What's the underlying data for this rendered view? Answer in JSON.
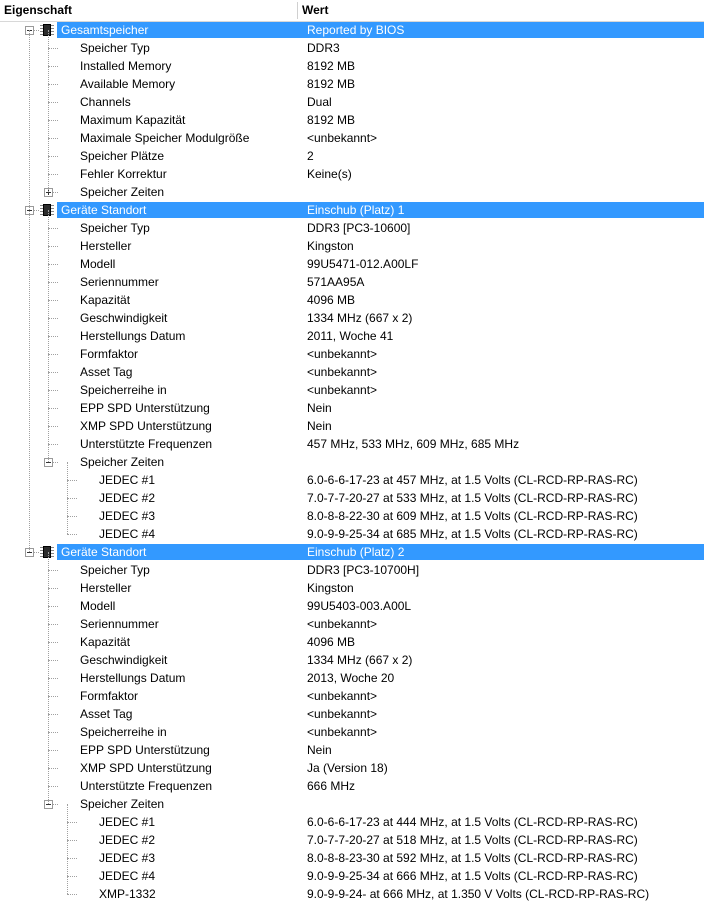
{
  "header": {
    "col1": "Eigenschaft",
    "col2": "Wert"
  },
  "rows": [
    {
      "level": 0,
      "label": "Gesamtspeicher",
      "value": "Reported by BIOS",
      "selected": true,
      "icon": "memory-chip-icon",
      "expander": "minus"
    },
    {
      "level": 1,
      "label": "Speicher Typ",
      "value": "DDR3"
    },
    {
      "level": 1,
      "label": "Installed Memory",
      "value": "8192 MB"
    },
    {
      "level": 1,
      "label": "Available Memory",
      "value": "8192 MB"
    },
    {
      "level": 1,
      "label": "Channels",
      "value": "Dual"
    },
    {
      "level": 1,
      "label": "Maximum Kapazität",
      "value": "8192 MB"
    },
    {
      "level": 1,
      "label": "Maximale Speicher Modulgröße",
      "value": "<unbekannt>"
    },
    {
      "level": 1,
      "label": "Speicher Plätze",
      "value": "2"
    },
    {
      "level": 1,
      "label": "Fehler Korrektur",
      "value": "Keine(s)"
    },
    {
      "level": 1,
      "label": "Speicher Zeiten",
      "value": "",
      "expander": "plus"
    },
    {
      "level": 0,
      "label": "Geräte Standort",
      "value": "Einschub (Platz) 1",
      "selected": true,
      "icon": "memory-chip-icon",
      "expander": "minus"
    },
    {
      "level": 1,
      "label": "Speicher Typ",
      "value": "DDR3 [PC3-10600]"
    },
    {
      "level": 1,
      "label": "Hersteller",
      "value": "Kingston"
    },
    {
      "level": 1,
      "label": "Modell",
      "value": "99U5471-012.A00LF"
    },
    {
      "level": 1,
      "label": "Seriennummer",
      "value": "571AA95A"
    },
    {
      "level": 1,
      "label": "Kapazität",
      "value": "4096 MB"
    },
    {
      "level": 1,
      "label": "Geschwindigkeit",
      "value": "1334 MHz (667 x 2)"
    },
    {
      "level": 1,
      "label": "Herstellungs Datum",
      "value": "2011, Woche 41"
    },
    {
      "level": 1,
      "label": "Formfaktor",
      "value": "<unbekannt>"
    },
    {
      "level": 1,
      "label": "Asset Tag",
      "value": "<unbekannt>"
    },
    {
      "level": 1,
      "label": "Speicherreihe in",
      "value": "<unbekannt>"
    },
    {
      "level": 1,
      "label": "EPP SPD Unterstützung",
      "value": "Nein"
    },
    {
      "level": 1,
      "label": "XMP SPD Unterstützung",
      "value": "Nein"
    },
    {
      "level": 1,
      "label": "Unterstützte Frequenzen",
      "value": "457 MHz, 533 MHz, 609 MHz, 685 MHz"
    },
    {
      "level": 1,
      "label": "Speicher Zeiten",
      "value": "",
      "expander": "minus"
    },
    {
      "level": 2,
      "label": "JEDEC #1",
      "value": "6.0-6-6-17-23 at 457 MHz, at 1.5 Volts (CL-RCD-RP-RAS-RC)"
    },
    {
      "level": 2,
      "label": "JEDEC #2",
      "value": "7.0-7-7-20-27 at 533 MHz, at 1.5 Volts (CL-RCD-RP-RAS-RC)"
    },
    {
      "level": 2,
      "label": "JEDEC #3",
      "value": "8.0-8-8-22-30 at 609 MHz, at 1.5 Volts (CL-RCD-RP-RAS-RC)"
    },
    {
      "level": 2,
      "label": "JEDEC #4",
      "value": "9.0-9-9-25-34 at 685 MHz, at 1.5 Volts (CL-RCD-RP-RAS-RC)"
    },
    {
      "level": 0,
      "label": "Geräte Standort",
      "value": "Einschub (Platz) 2",
      "selected": true,
      "icon": "memory-chip-icon",
      "expander": "minus"
    },
    {
      "level": 1,
      "label": "Speicher Typ",
      "value": "DDR3 [PC3-10700H]"
    },
    {
      "level": 1,
      "label": "Hersteller",
      "value": "Kingston"
    },
    {
      "level": 1,
      "label": "Modell",
      "value": "99U5403-003.A00L"
    },
    {
      "level": 1,
      "label": "Seriennummer",
      "value": "<unbekannt>"
    },
    {
      "level": 1,
      "label": "Kapazität",
      "value": "4096 MB"
    },
    {
      "level": 1,
      "label": "Geschwindigkeit",
      "value": "1334 MHz (667 x 2)"
    },
    {
      "level": 1,
      "label": "Herstellungs Datum",
      "value": "2013, Woche 20"
    },
    {
      "level": 1,
      "label": "Formfaktor",
      "value": "<unbekannt>"
    },
    {
      "level": 1,
      "label": "Asset Tag",
      "value": "<unbekannt>"
    },
    {
      "level": 1,
      "label": "Speicherreihe in",
      "value": "<unbekannt>"
    },
    {
      "level": 1,
      "label": "EPP SPD Unterstützung",
      "value": "Nein"
    },
    {
      "level": 1,
      "label": "XMP SPD Unterstützung",
      "value": "Ja (Version 18)"
    },
    {
      "level": 1,
      "label": "Unterstützte Frequenzen",
      "value": "666 MHz"
    },
    {
      "level": 1,
      "label": "Speicher Zeiten",
      "value": "",
      "expander": "minus"
    },
    {
      "level": 2,
      "label": "JEDEC #1",
      "value": "6.0-6-6-17-23 at 444 MHz, at 1.5 Volts (CL-RCD-RP-RAS-RC)"
    },
    {
      "level": 2,
      "label": "JEDEC #2",
      "value": "7.0-7-7-20-27 at 518 MHz, at 1.5 Volts (CL-RCD-RP-RAS-RC)"
    },
    {
      "level": 2,
      "label": "JEDEC #3",
      "value": "8.0-8-8-23-30 at 592 MHz, at 1.5 Volts (CL-RCD-RP-RAS-RC)"
    },
    {
      "level": 2,
      "label": "JEDEC #4",
      "value": "9.0-9-9-25-34 at 666 MHz, at 1.5 Volts (CL-RCD-RP-RAS-RC)"
    },
    {
      "level": 2,
      "label": "XMP-1332",
      "value": "9.0-9-9-24- at 666 MHz, at 1.350 V Volts (CL-RCD-RP-RAS-RC)"
    }
  ]
}
